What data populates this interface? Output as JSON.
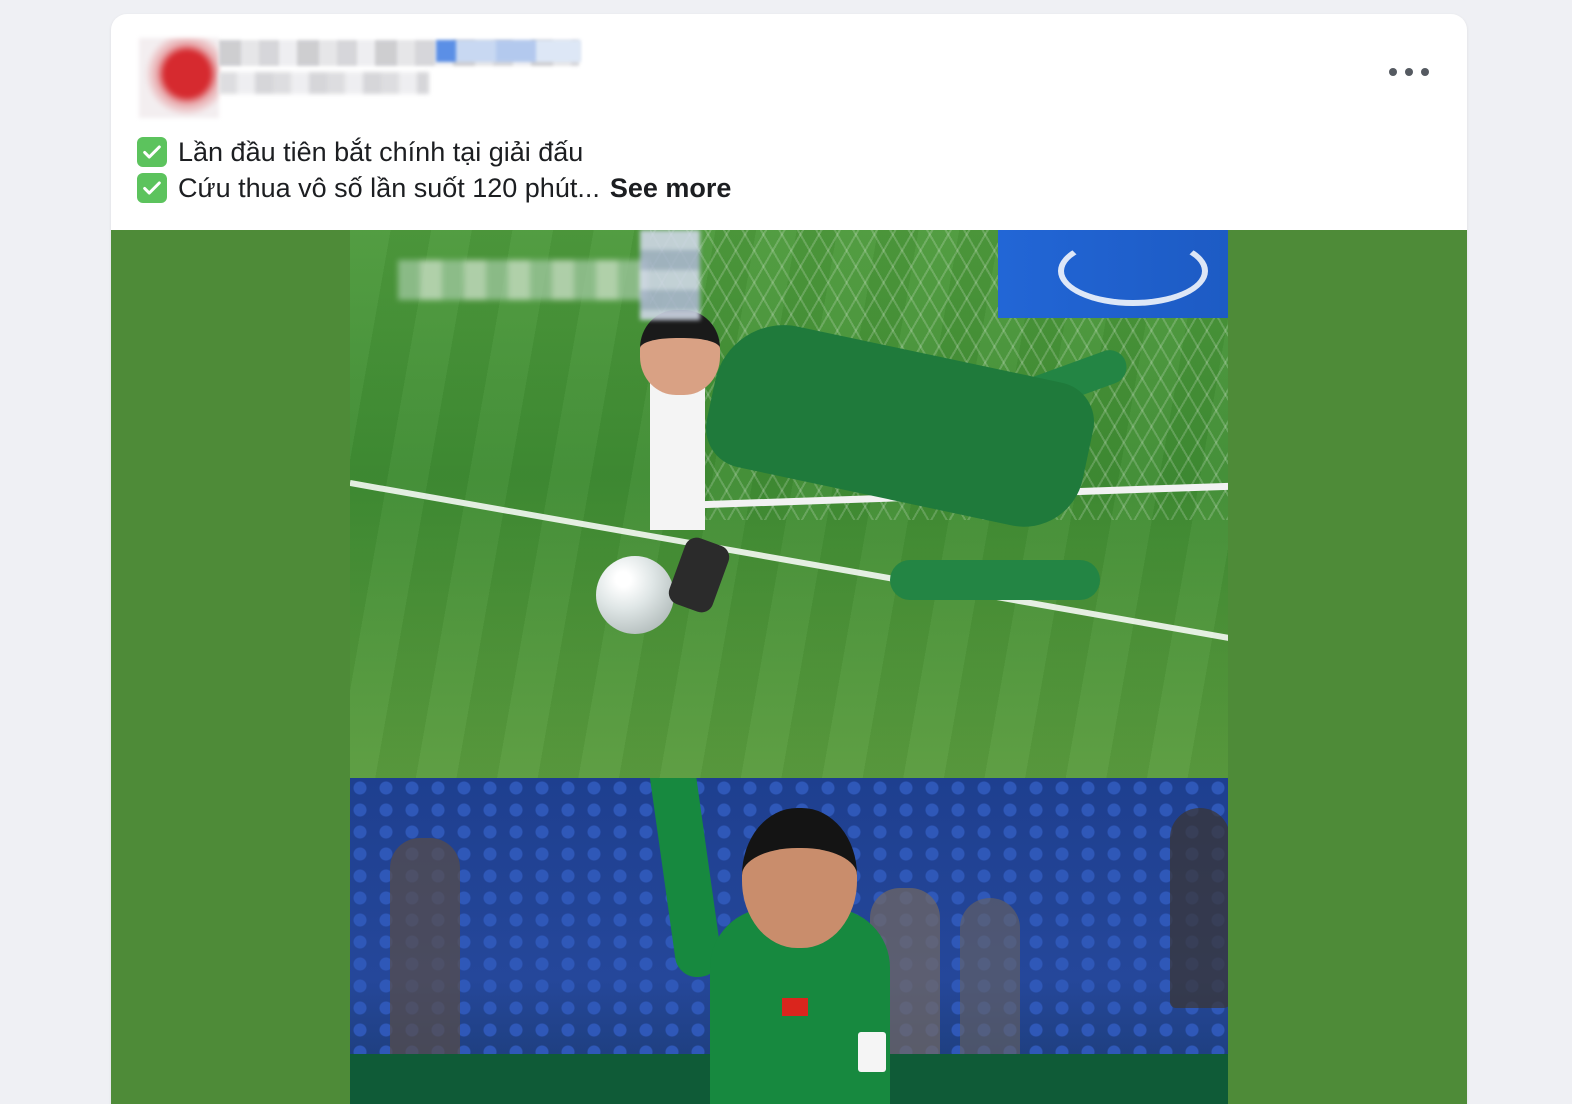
{
  "post": {
    "menu_label": "•••",
    "lines": [
      {
        "icon": "check-mark-icon",
        "text": "Lần đầu tiên bắt chính tại giải đấu"
      },
      {
        "icon": "check-mark-icon",
        "text": "Cứu thua vô số lần suốt 120 phút..."
      }
    ],
    "see_more": "See more"
  },
  "colors": {
    "page_bg": "#eff0f4",
    "card_bg": "#ffffff",
    "check_green": "#5cc35d",
    "media_bg": "#4e8b38",
    "text": "#1c1e21"
  },
  "media": {
    "photos": [
      "goalkeeper-diving-save-photo",
      "goalkeeper-raising-arm-photo"
    ]
  }
}
